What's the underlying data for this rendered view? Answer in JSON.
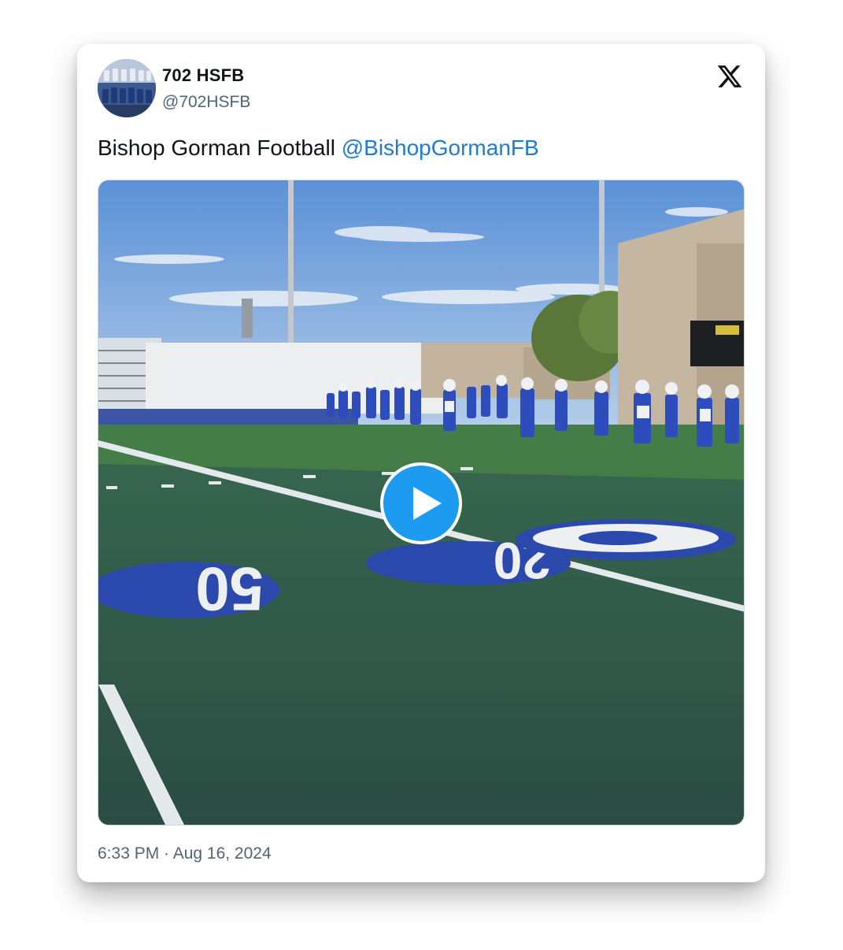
{
  "author": {
    "name": "702 HSFB",
    "handle": "@702HSFB"
  },
  "tweet": {
    "text": "Bishop Gorman Football",
    "mention": "@BishopGormanFB",
    "timestamp": "6:33 PM · Aug 16, 2024"
  },
  "media": {
    "type": "video",
    "scene": {
      "yard_numbers": [
        "50",
        "20"
      ]
    }
  },
  "icons": {
    "platform": "x-logo-icon",
    "play": "play-icon"
  },
  "colors": {
    "mention": "#1d7bd6",
    "play_button": "#1d9bf0",
    "text": "#0f1419",
    "secondary": "#536471"
  }
}
